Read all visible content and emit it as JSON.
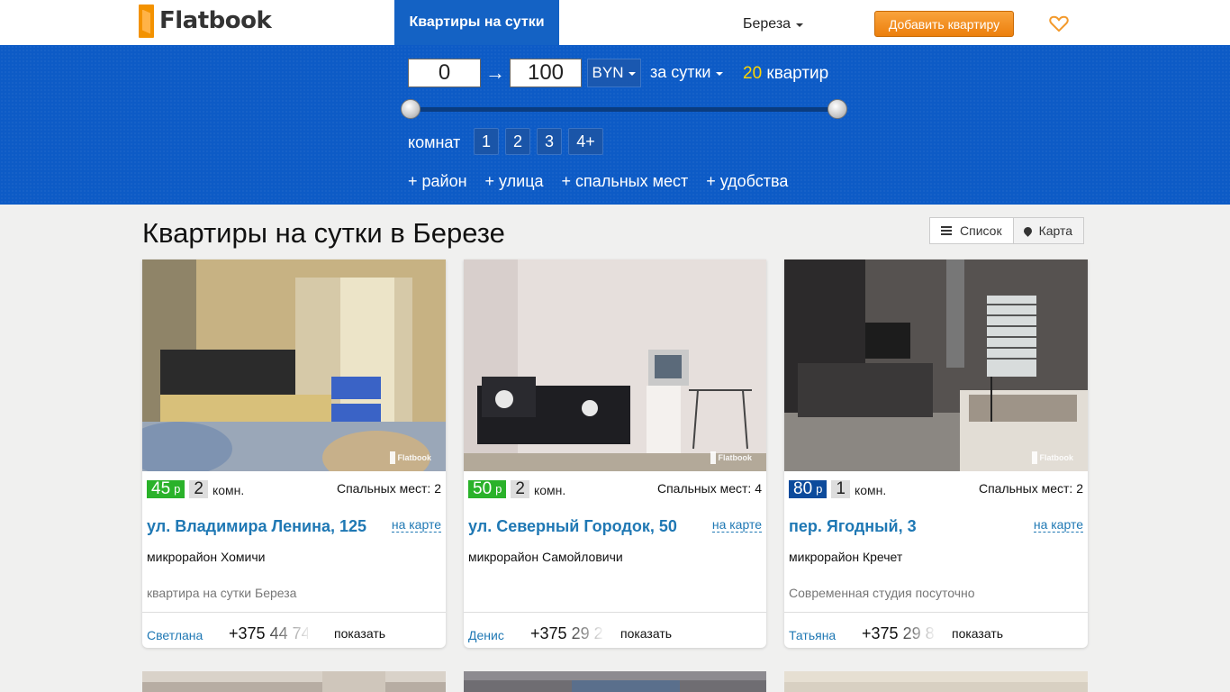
{
  "header": {
    "logo_text": "Flatbook",
    "nav_active": "Квартиры на сутки",
    "city": "Береза",
    "add_button": "Добавить квартиру"
  },
  "filters": {
    "price_min": "0",
    "price_max": "100",
    "arrow": "→",
    "currency": "BYN",
    "period": "за сутки",
    "count_num": "20",
    "count_label": "квартир",
    "price_slider_min": 0,
    "price_slider_max": 100,
    "rooms_label": "комнат",
    "rooms": [
      "1",
      "2",
      "3",
      "4+"
    ],
    "extra": [
      "+ район",
      "+ улица",
      "+ спальных мест",
      "+ удобства"
    ]
  },
  "main": {
    "title": "Квартиры на сутки в Березе",
    "view_list": "Список",
    "view_map": "Карта"
  },
  "listings": [
    {
      "price": "45",
      "price_unit": "р",
      "price_color": "#2ab22a",
      "rooms": "2",
      "rooms_unit": "комн.",
      "beds": "Спальных мест: 2",
      "address": "ул. Владимира Ленина, 125",
      "on_map": "на карте",
      "district": "микрорайон Хомичи",
      "description": "квартира на сутки Береза",
      "owner": "Светлана",
      "phone_visible": "+375",
      "phone_faded": "44 74",
      "show": "показать",
      "watermark": "Flatbook"
    },
    {
      "price": "50",
      "price_unit": "р",
      "price_color": "#2ab22a",
      "rooms": "2",
      "rooms_unit": "комн.",
      "beds": "Спальных мест: 4",
      "address": "ул. Северный Городок, 50",
      "on_map": "на карте",
      "district": "микрорайон Самойловичи",
      "description": "",
      "owner": "Денис",
      "phone_visible": "+375",
      "phone_faded": "29 2",
      "show": "показать",
      "watermark": "Flatbook"
    },
    {
      "price": "80",
      "price_unit": "р",
      "price_color": "#0d4b9c",
      "rooms": "1",
      "rooms_unit": "комн.",
      "beds": "Спальных мест: 2",
      "address": "пер. Ягодный, 3",
      "on_map": "на карте",
      "district": "микрорайон Кречет",
      "description": "Современная студия посуточно",
      "owner": "Татьяна",
      "phone_visible": "+375",
      "phone_faded": "29 8",
      "show": "показать",
      "watermark": "Flatbook"
    }
  ]
}
